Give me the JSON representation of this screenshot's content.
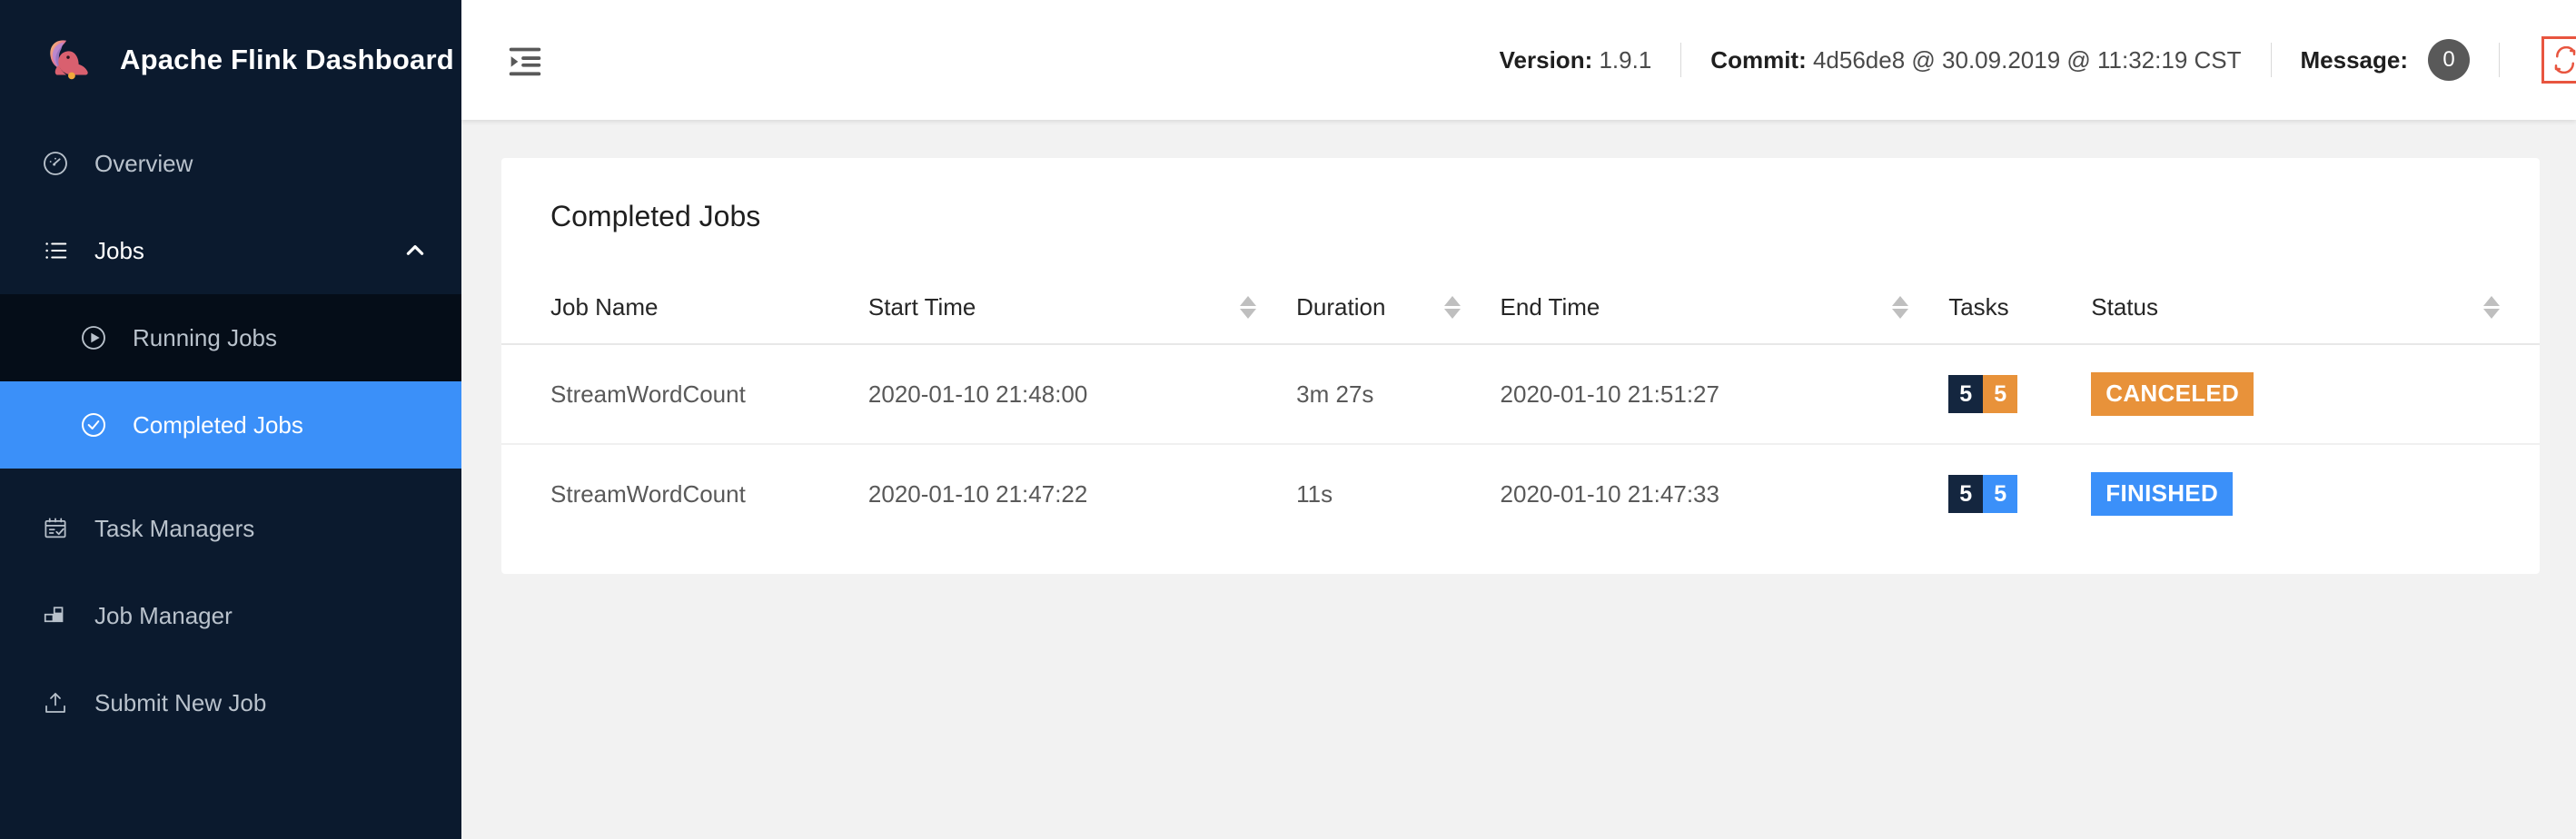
{
  "brand": {
    "title": "Apache Flink Dashboard",
    "logo_icon": "flink-squirrel-logo"
  },
  "sidebar": {
    "background_color": "#0b1a2e",
    "active_color": "#3b90f9",
    "items": [
      {
        "label": "Overview",
        "icon": "dashboard-gauge-icon",
        "active": false
      },
      {
        "label": "Jobs",
        "icon": "list-icon",
        "active": false,
        "expanded": true,
        "chevron": "chevron-up-icon"
      },
      {
        "label": "Task Managers",
        "icon": "schedule-calendar-check-icon",
        "active": false
      },
      {
        "label": "Job Manager",
        "icon": "blocks-icon",
        "active": false
      },
      {
        "label": "Submit New Job",
        "icon": "upload-icon",
        "active": false
      }
    ],
    "sub_items": [
      {
        "label": "Running Jobs",
        "icon": "play-circle-icon",
        "active": false
      },
      {
        "label": "Completed Jobs",
        "icon": "check-circle-icon",
        "active": true
      }
    ]
  },
  "topbar": {
    "fold_icon": "menu-fold-icon",
    "version_label": "Version:",
    "version_value": "1.9.1",
    "commit_label": "Commit:",
    "commit_value": "4d56de8 @ 30.09.2019 @ 11:32:19 CST",
    "message_label": "Message:",
    "message_count": "0",
    "refresh_icon": "refresh-sync-icon",
    "refresh_border_color": "#e8553f"
  },
  "main": {
    "card_title": "Completed Jobs",
    "table": {
      "columns": [
        {
          "label": "Job Name",
          "sortable": false
        },
        {
          "label": "Start Time",
          "sortable": true
        },
        {
          "label": "Duration",
          "sortable": true
        },
        {
          "label": "End Time",
          "sortable": true
        },
        {
          "label": "Tasks",
          "sortable": false
        },
        {
          "label": "Status",
          "sortable": true
        }
      ],
      "rows": [
        {
          "job_name": "StreamWordCount",
          "start_time": "2020-01-10 21:48:00",
          "duration": "3m 27s",
          "end_time": "2020-01-10 21:51:27",
          "tasks": [
            {
              "count": "5",
              "color": "#14263f"
            },
            {
              "count": "5",
              "color": "#e8923a"
            }
          ],
          "status": "CANCELED",
          "status_color": "#e8923a"
        },
        {
          "job_name": "StreamWordCount",
          "start_time": "2020-01-10 21:47:22",
          "duration": "11s",
          "end_time": "2020-01-10 21:47:33",
          "tasks": [
            {
              "count": "5",
              "color": "#14263f"
            },
            {
              "count": "5",
              "color": "#3b90f9"
            }
          ],
          "status": "FINISHED",
          "status_color": "#3b90f9"
        }
      ]
    }
  }
}
